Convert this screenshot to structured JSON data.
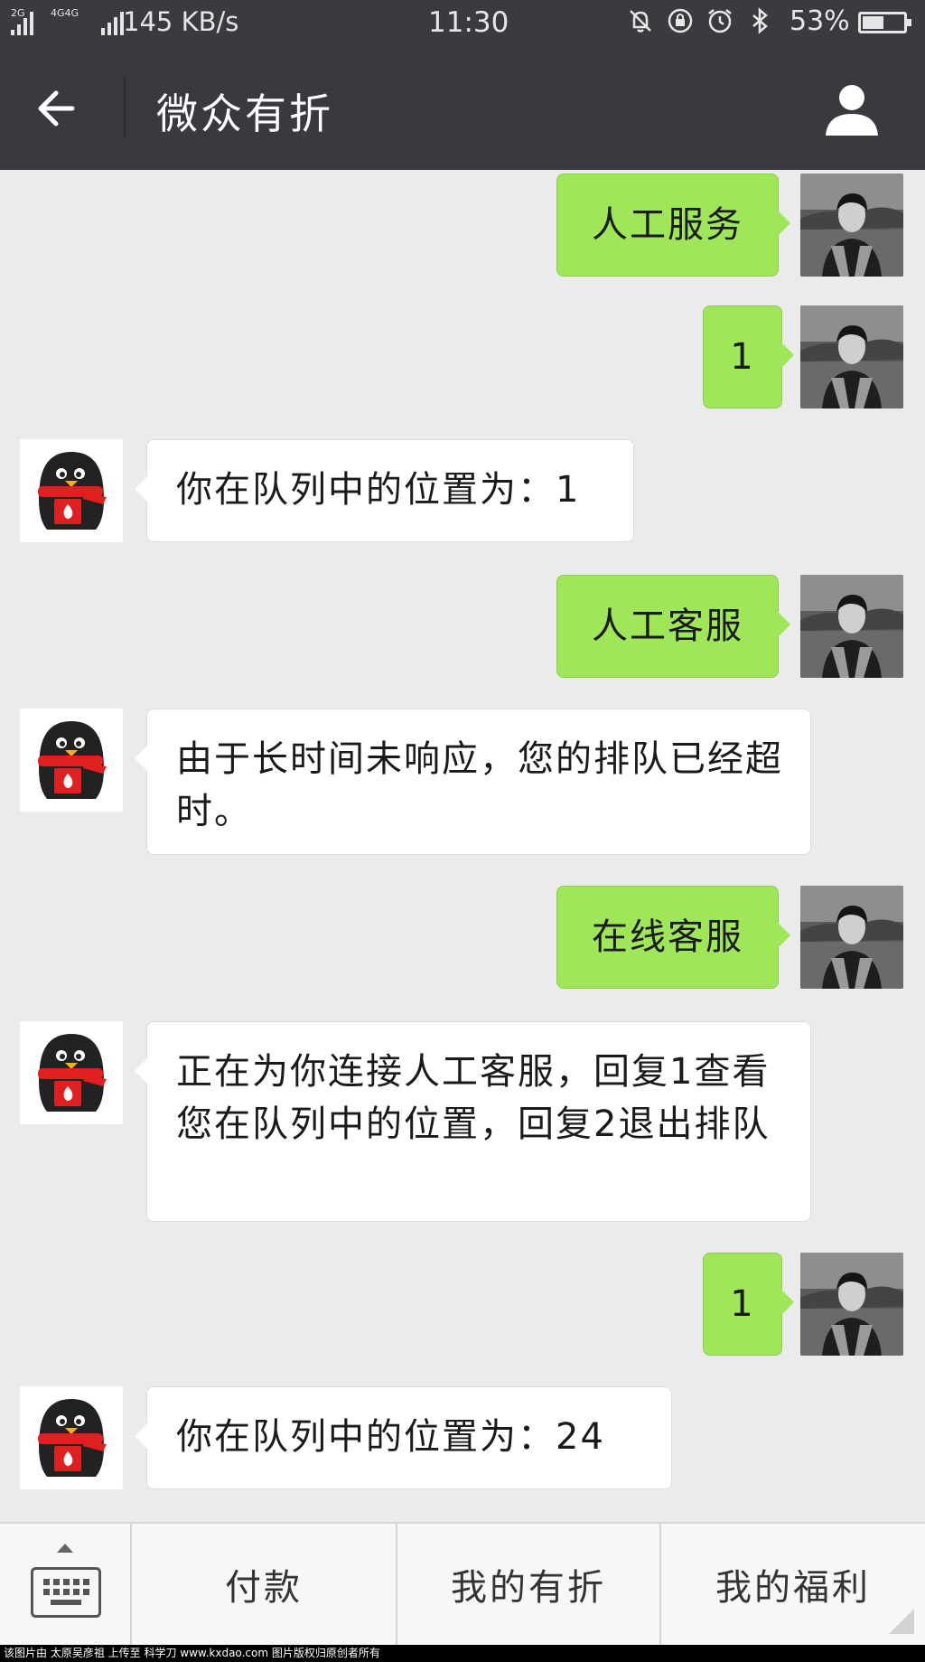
{
  "status_bar": {
    "signal1_tag": "2G",
    "signal2_tag": "4G4G",
    "net_speed": "145 KB/s",
    "time": "11:30",
    "battery_percent": "53%",
    "battery_level": 0.53,
    "icons": [
      "bell-off-icon",
      "rotation-lock-icon",
      "alarm-icon",
      "bluetooth-icon"
    ]
  },
  "header": {
    "title": "微众有折",
    "back_icon": "arrow-left-icon",
    "profile_icon": "person-icon"
  },
  "messages": [
    {
      "sender": "me",
      "text": "人工服务"
    },
    {
      "sender": "me",
      "text": "1"
    },
    {
      "sender": "bot",
      "text": "你在队列中的位置为：1"
    },
    {
      "sender": "me",
      "text": "人工客服"
    },
    {
      "sender": "bot",
      "text": "由于长时间未响应，您的排队已经超时。"
    },
    {
      "sender": "me",
      "text": "在线客服"
    },
    {
      "sender": "bot",
      "text": "正在为你连接人工客服，回复1查看您在队列中的位置，回复2退出排队"
    },
    {
      "sender": "me",
      "text": "1"
    },
    {
      "sender": "bot",
      "text": "你在队列中的位置为：24"
    }
  ],
  "bottom_menu": {
    "keyboard_icon": "keyboard-icon",
    "items": [
      {
        "label": "付款"
      },
      {
        "label": "我的有折"
      },
      {
        "label": "我的福利"
      }
    ]
  },
  "footer_text": "该图片由 太原吴彦祖 上传至 科学刀 www.kxdao.com 图片版权归原创者所有",
  "colors": {
    "header_bg": "#393a3f",
    "chat_bg": "#ebebeb",
    "my_bubble": "#9fe658",
    "bot_bubble": "#ffffff"
  }
}
